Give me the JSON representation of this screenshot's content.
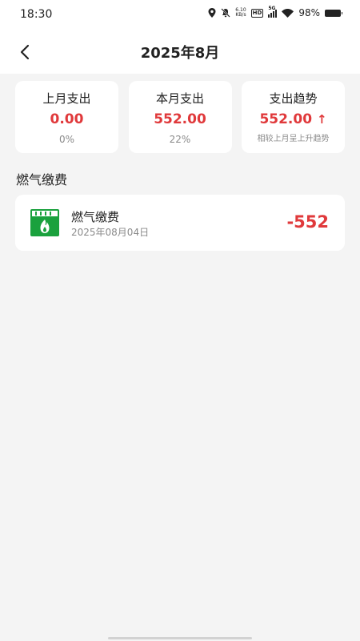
{
  "status_bar": {
    "time": "18:30",
    "net_speed_value": "6.10",
    "net_speed_unit": "KB/s",
    "hd_badge": "HD",
    "network": "5G",
    "battery": "98%"
  },
  "nav": {
    "title": "2025年8月"
  },
  "stats": [
    {
      "label": "上月支出",
      "value": "0.00",
      "sub": "0%"
    },
    {
      "label": "本月支出",
      "value": "552.00",
      "sub": "22%"
    },
    {
      "label": "支出趋势",
      "value": "552.00",
      "arrow": "↑",
      "sub": "相较上月呈上升趋势"
    }
  ],
  "section": {
    "title": "燃气缴费"
  },
  "bills": [
    {
      "name": "燃气缴费",
      "date": "2025年08月04日",
      "amount": "-552",
      "icon": "gas-fee-icon"
    }
  ],
  "colors": {
    "accent_red": "#e0393b",
    "icon_green": "#1aa13d",
    "background": "#f4f4f4",
    "card": "#ffffff"
  }
}
